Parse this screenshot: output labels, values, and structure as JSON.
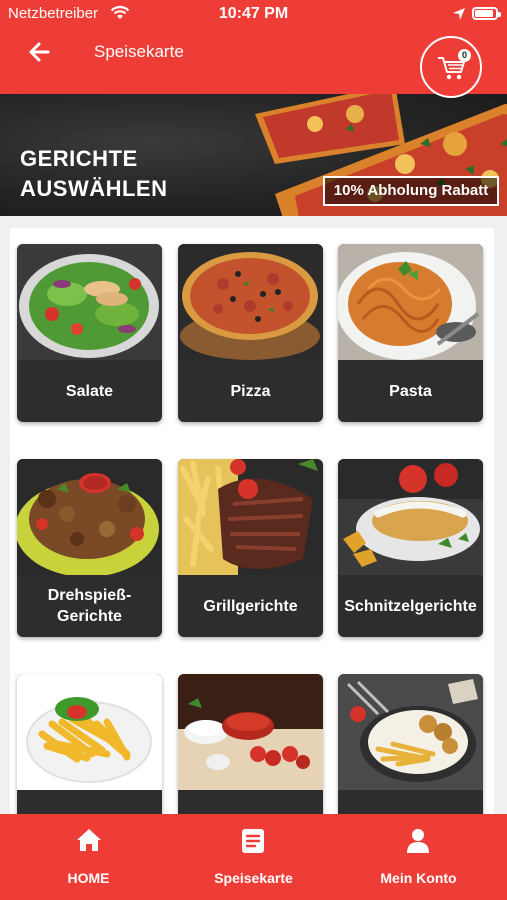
{
  "status_bar": {
    "carrier": "Netzbetreiber",
    "time": "10:47 PM"
  },
  "app_bar": {
    "title": "Speisekarte",
    "cart_count": "0"
  },
  "banner": {
    "title_line1": "GERICHTE",
    "title_line2": "AUSWÄHLEN",
    "promo": "10% Abholung Rabatt"
  },
  "categories": [
    {
      "label": "Salate",
      "icon": "salad-image"
    },
    {
      "label": "Pizza",
      "icon": "pizza-image"
    },
    {
      "label": "Pasta",
      "icon": "pasta-image"
    },
    {
      "label": "Drehspieß-\nGerichte",
      "icon": "skewer-image"
    },
    {
      "label": "Grillgerichte",
      "icon": "steak-image"
    },
    {
      "label": "Schnitzelgerichte",
      "icon": "schnitzel-image"
    },
    {
      "label": "",
      "icon": "fries-image"
    },
    {
      "label": "",
      "icon": "dips-image"
    },
    {
      "label": "",
      "icon": "snacks-image"
    }
  ],
  "bottom_nav": [
    {
      "label": "HOME",
      "icon": "home-icon"
    },
    {
      "label": "Speisekarte",
      "icon": "menu-icon"
    },
    {
      "label": "Mein Konto",
      "icon": "account-icon"
    }
  ],
  "colors": {
    "primary": "#ee3d36",
    "card": "#2d2d2d"
  }
}
